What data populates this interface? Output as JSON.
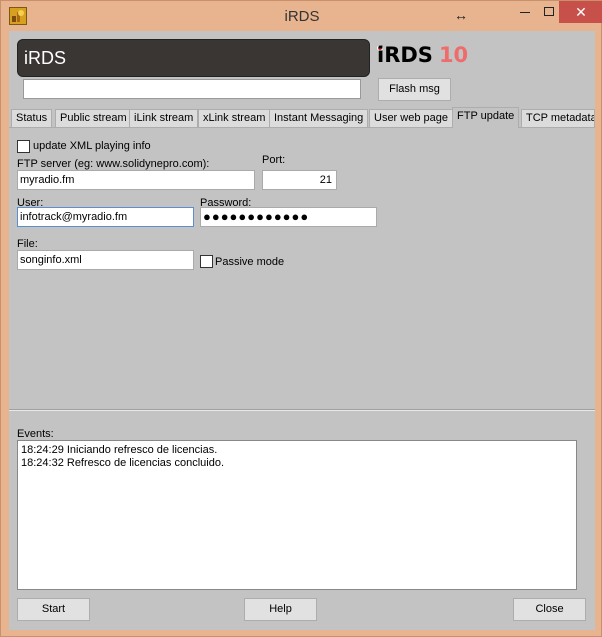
{
  "window": {
    "title": "iRDS",
    "resize_glyph": "↔",
    "close_glyph": "✕"
  },
  "header": {
    "display_text": "iRDS",
    "logo_text": "iRDS",
    "logo_number": "10",
    "flash_input_value": "",
    "flash_button_label": "Flash msg"
  },
  "tabs": [
    {
      "label": "Status"
    },
    {
      "label": "Public stream"
    },
    {
      "label": "iLink stream"
    },
    {
      "label": "xLink stream"
    },
    {
      "label": "Instant Messaging"
    },
    {
      "label": "User web page"
    },
    {
      "label": "FTP update",
      "active": true
    },
    {
      "label": "TCP metadata"
    }
  ],
  "ftp": {
    "update_xml_label": "update XML playing info",
    "update_xml_checked": false,
    "server_label": "FTP server (eg: www.solidynepro.com):",
    "server_value": "myradio.fm",
    "port_label": "Port:",
    "port_value": "21",
    "user_label": "User:",
    "user_value": "infotrack@myradio.fm",
    "password_label": "Password:",
    "password_value": "●●●●●●●●●●●●",
    "file_label": "File:",
    "file_value": "songinfo.xml",
    "passive_label": "Passive mode",
    "passive_checked": false
  },
  "events": {
    "label": "Events:",
    "lines": [
      "18:24:29 Iniciando refresco de licencias.",
      "18:24:32 Refresco de licencias concluido."
    ]
  },
  "footer": {
    "start_label": "Start",
    "help_label": "Help",
    "close_label": "Close"
  },
  "colors": {
    "frame": "#e8b48f",
    "client": "#c3c3c3",
    "display_bg": "#3a3633",
    "logo_accent": "#ee6c6c",
    "close_button": "#c7504a"
  },
  "icons": [
    "app-icon",
    "resize-icon",
    "minimize-icon",
    "maximize-icon",
    "close-icon"
  ]
}
